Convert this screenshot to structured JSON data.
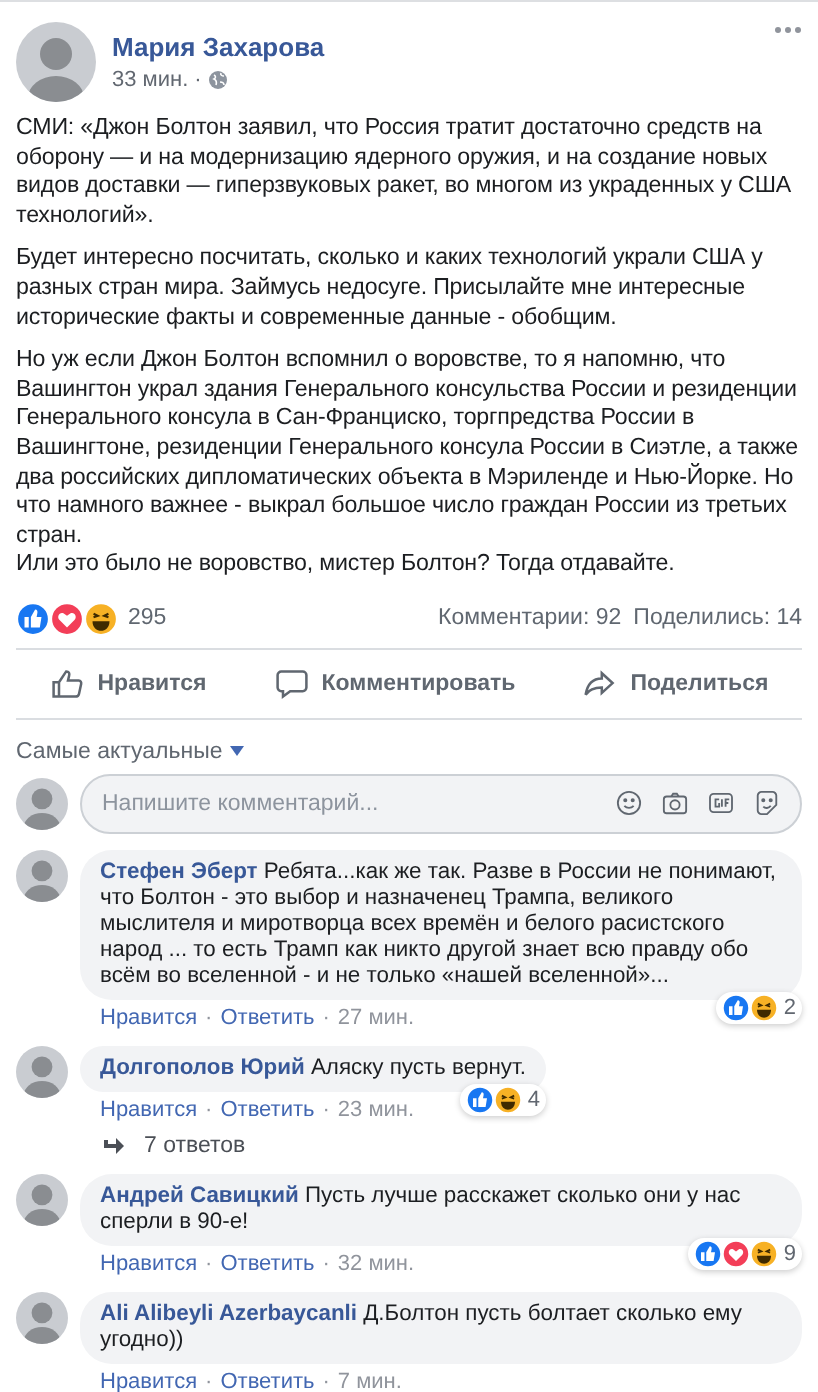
{
  "post": {
    "author": "Мария Захарова",
    "time": "33 мин.",
    "separator": "·",
    "paragraphs": [
      "СМИ: «Джон Болтон заявил, что Россия тратит достаточно средств на оборону — и на модернизацию ядерного оружия, и на создание новых видов доставки — гиперзвуковых ракет, во многом из украденных у США технологий».",
      "Будет интересно посчитать, сколько и каких технологий украли США у разных стран мира. Займусь недосуге. Присылайте мне интересные исторические факты и современные данные - обобщим.",
      "Но уж если Джон Болтон вспомнил о воровстве, то я напомню, что Вашингтон украл здания Генерального консульства России и резиденции Генерального консула в Сан-Франциско, торгпредства России в Вашингтоне, резиденции Генерального консула России в Сиэтле, а также два российских дипломатических объекта в Мэриленде и Нью-Йорке. Но что намного важнее - выкрал большое число граждан России из третьих стран.\nИли это было не воровство, мистер Болтон? Тогда отдавайте."
    ],
    "reactions": [
      {
        "kind": "like"
      },
      {
        "kind": "love"
      },
      {
        "kind": "haha"
      }
    ],
    "reaction_count": "295",
    "comments_count": "Комментарии: 92",
    "shares_count": "Поделились: 14"
  },
  "actions": [
    {
      "kind": "like",
      "label": "Нравится"
    },
    {
      "kind": "comment",
      "label": "Комментировать"
    },
    {
      "kind": "share",
      "label": "Поделиться"
    }
  ],
  "sort": {
    "label": "Самые актуальные"
  },
  "composer": {
    "placeholder": "Напишите комментарий..."
  },
  "comments": [
    {
      "author": "Стефен Эберт",
      "text": "Ребята...как же так. Разве в России не понимают, что Болтон - это выбор и назначенец Трампа, великого мыслителя и миротворца всех времён и белого расистского народ ... то есть Трамп как никто другой знает всю правду обо всём во вселенной - и не только «нашей вселенной»...",
      "reactions": [
        {
          "kind": "like"
        },
        {
          "kind": "haha"
        }
      ],
      "reaction_count": "2",
      "like": "Нравится",
      "separator": "·",
      "reply": "Ответить",
      "time": "27 мин."
    },
    {
      "author": "Долгополов Юрий",
      "text": "Аляску пусть вернут.",
      "reactions": [
        {
          "kind": "like"
        },
        {
          "kind": "haha"
        }
      ],
      "reaction_count": "4",
      "like": "Нравится",
      "separator": "·",
      "reply": "Ответить",
      "time": "23 мин.",
      "replies": "7 ответов"
    },
    {
      "author": "Андрей Савицкий",
      "text": "Пусть лучше расскажет сколько они у нас сперли в 90-е!",
      "reactions": [
        {
          "kind": "like"
        },
        {
          "kind": "love"
        },
        {
          "kind": "haha"
        }
      ],
      "reaction_count": "9",
      "like": "Нравится",
      "separator": "·",
      "reply": "Ответить",
      "time": "32 мин."
    },
    {
      "author": "Ali Alibeyli Azerbaycanli",
      "text": "Д.Болтон пусть болтает сколько ему угодно))",
      "like": "Нравится",
      "separator": "·",
      "reply": "Ответить",
      "time": "7 мин."
    }
  ]
}
